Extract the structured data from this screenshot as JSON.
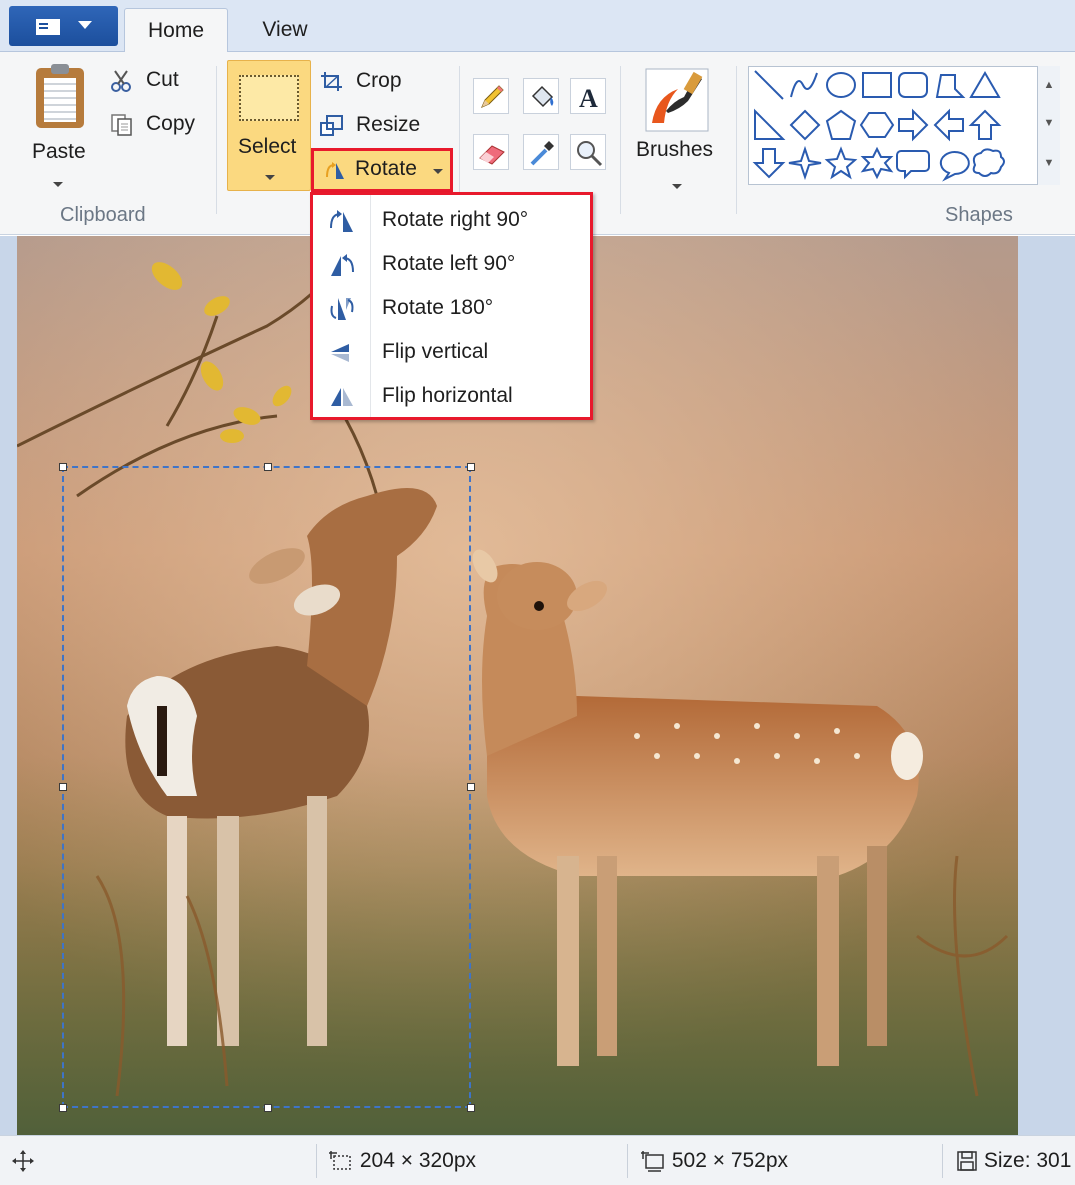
{
  "tabs": {
    "file_menu": "file-menu",
    "home": "Home",
    "view": "View"
  },
  "clipboard": {
    "paste": "Paste",
    "cut": "Cut",
    "copy": "Copy",
    "group_label": "Clipboard"
  },
  "image": {
    "select": "Select",
    "crop": "Crop",
    "resize": "Resize",
    "rotate": "Rotate"
  },
  "tools": {
    "items": [
      "pencil",
      "fill-with-color",
      "text",
      "eraser",
      "color-picker",
      "magnifier"
    ]
  },
  "brushes": {
    "label": "Brushes"
  },
  "shapes": {
    "group_label": "Shapes",
    "items": [
      "line",
      "curve",
      "oval",
      "rectangle",
      "rounded-rectangle",
      "polygon",
      "triangle",
      "right-triangle",
      "diamond",
      "pentagon",
      "hexagon",
      "right-arrow",
      "left-arrow",
      "up-arrow",
      "down-arrow",
      "four-point-star",
      "five-point-star",
      "six-point-star",
      "rounded-callout",
      "oval-callout",
      "cloud-callout"
    ]
  },
  "rotate_menu": {
    "items": [
      {
        "label": "Rotate right 90°",
        "icon": "rotate-right-icon"
      },
      {
        "label": "Rotate left 90°",
        "icon": "rotate-left-icon"
      },
      {
        "label": "Rotate 180°",
        "icon": "rotate-180-icon"
      },
      {
        "label": "Flip vertical",
        "icon": "flip-vertical-icon"
      },
      {
        "label": "Flip horizontal",
        "icon": "flip-horizontal-icon"
      }
    ]
  },
  "status": {
    "selection_size": "204 × 320px",
    "image_size": "502 × 752px",
    "file_size": "Size: 301"
  },
  "colors": {
    "accent_highlight": "#e8192c",
    "selected_button": "#fbd980",
    "ribbon_blue": "#1c4f9d"
  }
}
